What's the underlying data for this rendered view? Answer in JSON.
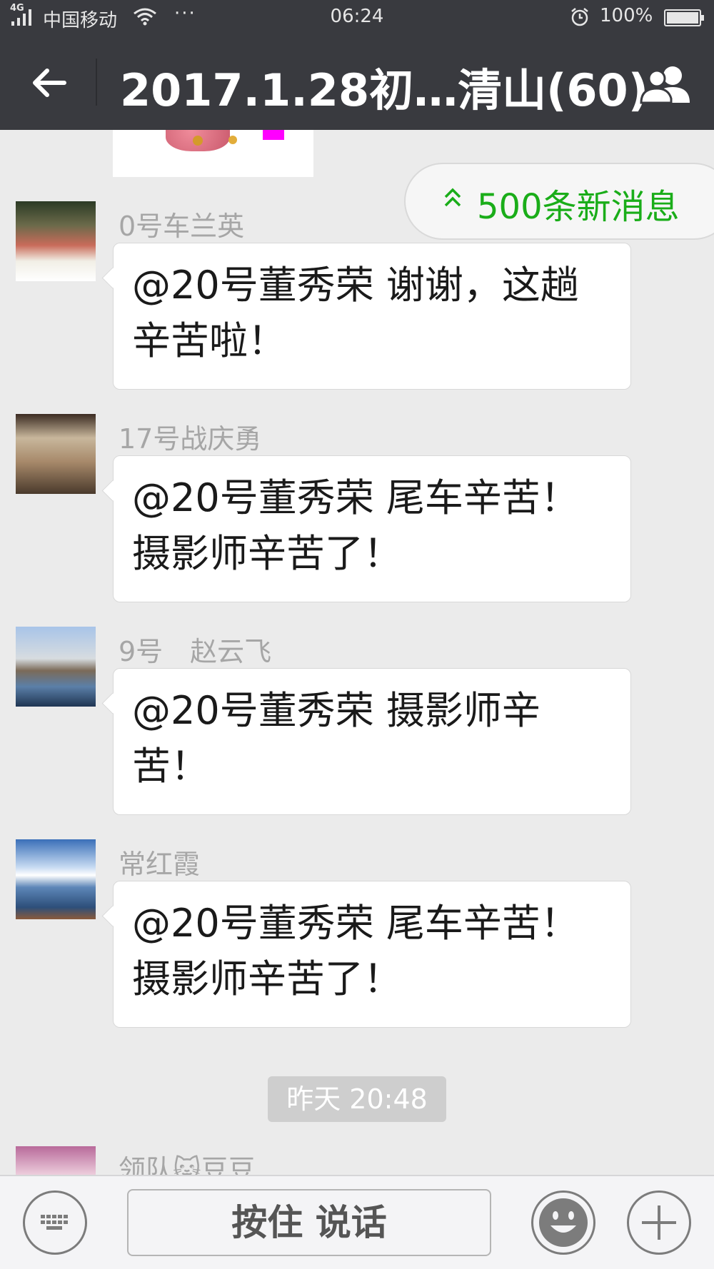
{
  "status_bar": {
    "network": "4G",
    "carrier": "中国移动",
    "more": "···",
    "time": "06:24",
    "battery": "100%"
  },
  "header": {
    "title": "2017.1.28初…清山(60)"
  },
  "new_messages": {
    "label": "500条新消息"
  },
  "messages": [
    {
      "sender": "0号车兰英",
      "text": "@20号董秀荣 谢谢，这趟辛苦啦！"
    },
    {
      "sender": "17号战庆勇",
      "text": "@20号董秀荣 尾车辛苦！摄影师辛苦了！"
    },
    {
      "sender": "9号　赵云飞",
      "text": "@20号董秀荣 摄影师辛苦！"
    },
    {
      "sender": "常红霞",
      "text": "@20号董秀荣 尾车辛苦！摄影师辛苦了！"
    }
  ],
  "timestamp": "昨天 20:48",
  "partial_message": {
    "sender": "领队🐱豆豆"
  },
  "input_bar": {
    "talk_label": "按住 说话"
  },
  "icons": {
    "back": "back-arrow-icon",
    "group": "group-members-icon",
    "keyboard": "keyboard-icon",
    "emoji": "emoji-icon",
    "plus": "plus-icon"
  },
  "colors": {
    "header_bg": "#393a3f",
    "chat_bg": "#ebebeb",
    "accent_green": "#1aad19"
  }
}
